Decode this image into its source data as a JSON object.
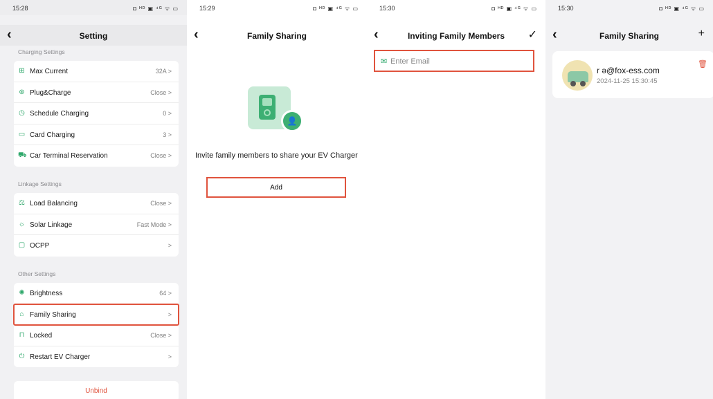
{
  "screen1": {
    "status_time": "15:28",
    "status_icons": "◘ ᴴᴰ ▣ ⁴ᴳ ᯤ ▭",
    "nav_back": "‹",
    "nav_title": "Setting",
    "groups": [
      {
        "label": "Charging Settings",
        "items": [
          {
            "label": "Max Current",
            "value": "32A >",
            "icon": "current-icon",
            "glyph": "⊞"
          },
          {
            "label": "Plug&Charge",
            "value": "Close >",
            "icon": "plug-icon",
            "glyph": "⊛"
          },
          {
            "label": "Schedule Charging",
            "value": "0 >",
            "icon": "clock-icon",
            "glyph": "◷"
          },
          {
            "label": "Card Charging",
            "value": "3 >",
            "icon": "card-icon",
            "glyph": "▭"
          },
          {
            "label": "Car Terminal Reservation",
            "value": "Close >",
            "icon": "car-icon",
            "glyph": "⛟"
          }
        ]
      },
      {
        "label": "Linkage Settings",
        "items": [
          {
            "label": "Load Balancing",
            "value": "Close >",
            "icon": "balance-icon",
            "glyph": "⚖"
          },
          {
            "label": "Solar Linkage",
            "value": "Fast Mode >",
            "icon": "sun-icon",
            "glyph": "☼"
          },
          {
            "label": "OCPP",
            "value": ">",
            "icon": "monitor-icon",
            "glyph": "▢"
          }
        ]
      },
      {
        "label": "Other Settings",
        "items": [
          {
            "label": "Brightness",
            "value": "64 >",
            "icon": "brightness-icon",
            "glyph": "✺"
          },
          {
            "label": "Family Sharing",
            "value": ">",
            "icon": "family-icon",
            "glyph": "⌂"
          },
          {
            "label": "Locked",
            "value": "Close >",
            "icon": "lock-icon",
            "glyph": "⊓"
          },
          {
            "label": "Restart EV Charger",
            "value": ">",
            "icon": "power-icon",
            "glyph": "⏻"
          }
        ]
      }
    ],
    "unbind_label": "Unbind"
  },
  "screen2": {
    "status_time": "15:29",
    "status_icons": "◘ ᴴᴰ ▣ ⁴ᴳ ᯤ ▭",
    "nav_back": "‹",
    "nav_title": "Family Sharing",
    "invite_text": "Invite family members to share your EV Charger",
    "add_label": "Add"
  },
  "screen3": {
    "status_time": "15:30",
    "status_icons": "◘ ᴴᴰ ▣ ⁴ᴳ ᯤ ▭",
    "nav_back": "‹",
    "nav_title": "Inviting Family Members",
    "confirm_glyph": "✓",
    "email_placeholder": "Enter Email",
    "email_value": ""
  },
  "screen4": {
    "status_time": "15:30",
    "status_icons": "◘ ᴴᴰ ▣ ⁴ᴳ ᯤ ▭",
    "nav_back": "‹",
    "nav_title": "Family Sharing",
    "add_glyph": "+",
    "member": {
      "email": "r  ə@fox-ess.com",
      "date": "2024-11-25 15:30:45"
    }
  },
  "colors": {
    "accent_green": "#2fa86b",
    "highlight_red": "#e0533d"
  }
}
